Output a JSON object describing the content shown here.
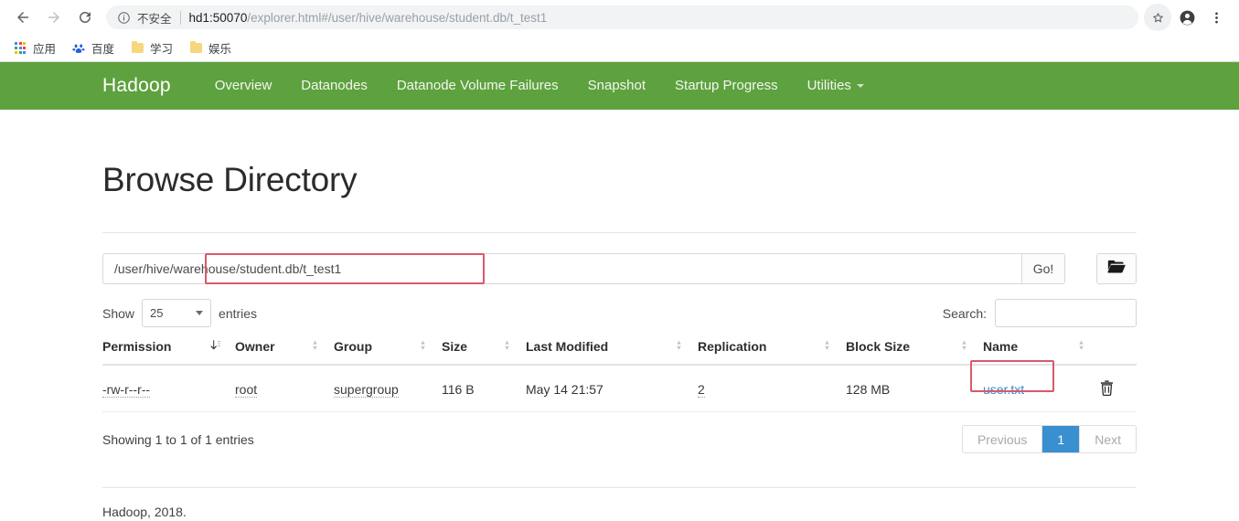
{
  "browser": {
    "back_icon": "back-arrow-icon",
    "forward_icon": "forward-arrow-icon",
    "reload_icon": "reload-icon",
    "info_icon": "info-circle-icon",
    "security_label": "不安全",
    "url_host": "hd1:50070",
    "url_path": "/explorer.html#/user/hive/warehouse/student.db/t_test1",
    "star_icon": "star-icon",
    "profile_icon": "profile-avatar-icon",
    "menu_icon": "three-dot-menu-icon",
    "bookmarks": [
      {
        "label": "应用",
        "icon": "apps-grid-icon"
      },
      {
        "label": "百度",
        "icon": "baidu-paw-icon"
      },
      {
        "label": "学习",
        "icon": "folder-icon"
      },
      {
        "label": "娱乐",
        "icon": "folder-icon"
      }
    ]
  },
  "navbar": {
    "brand": "Hadoop",
    "color": "#5ea13f",
    "links": [
      {
        "label": "Overview"
      },
      {
        "label": "Datanodes"
      },
      {
        "label": "Datanode Volume Failures"
      },
      {
        "label": "Snapshot"
      },
      {
        "label": "Startup Progress"
      },
      {
        "label": "Utilities",
        "has_caret": true
      }
    ]
  },
  "page": {
    "title": "Browse Directory",
    "path_value": "/user/hive/warehouse/student.db/t_test1",
    "path_placeholder": "Enter a directory path",
    "go_label": "Go!",
    "folder_icon": "open-folder-icon",
    "show_label": "Show",
    "entries_value": "25",
    "entries_label": "entries",
    "search_label": "Search:",
    "search_value": "",
    "search_placeholder": "",
    "annotation_color": "#d9596b"
  },
  "table": {
    "columns": [
      {
        "label": "Permission",
        "sort": "desc"
      },
      {
        "label": "Owner",
        "sort": "none"
      },
      {
        "label": "Group",
        "sort": "none"
      },
      {
        "label": "Size",
        "sort": "none"
      },
      {
        "label": "Last Modified",
        "sort": "none"
      },
      {
        "label": "Replication",
        "sort": "none"
      },
      {
        "label": "Block Size",
        "sort": "none"
      },
      {
        "label": "Name",
        "sort": "none"
      }
    ],
    "rows": [
      {
        "permission": "-rw-r--r--",
        "owner": "root",
        "group": "supergroup",
        "size": "116 B",
        "last_modified": "May 14 21:57",
        "replication": "2",
        "block_size": "128 MB",
        "name": "user.txt",
        "delete_icon": "trash-icon"
      }
    ]
  },
  "footer": {
    "showing_info": "Showing 1 to 1 of 1 entries",
    "pagination": {
      "previous": "Previous",
      "page": "1",
      "next": "Next"
    },
    "copyright": "Hadoop, 2018."
  }
}
